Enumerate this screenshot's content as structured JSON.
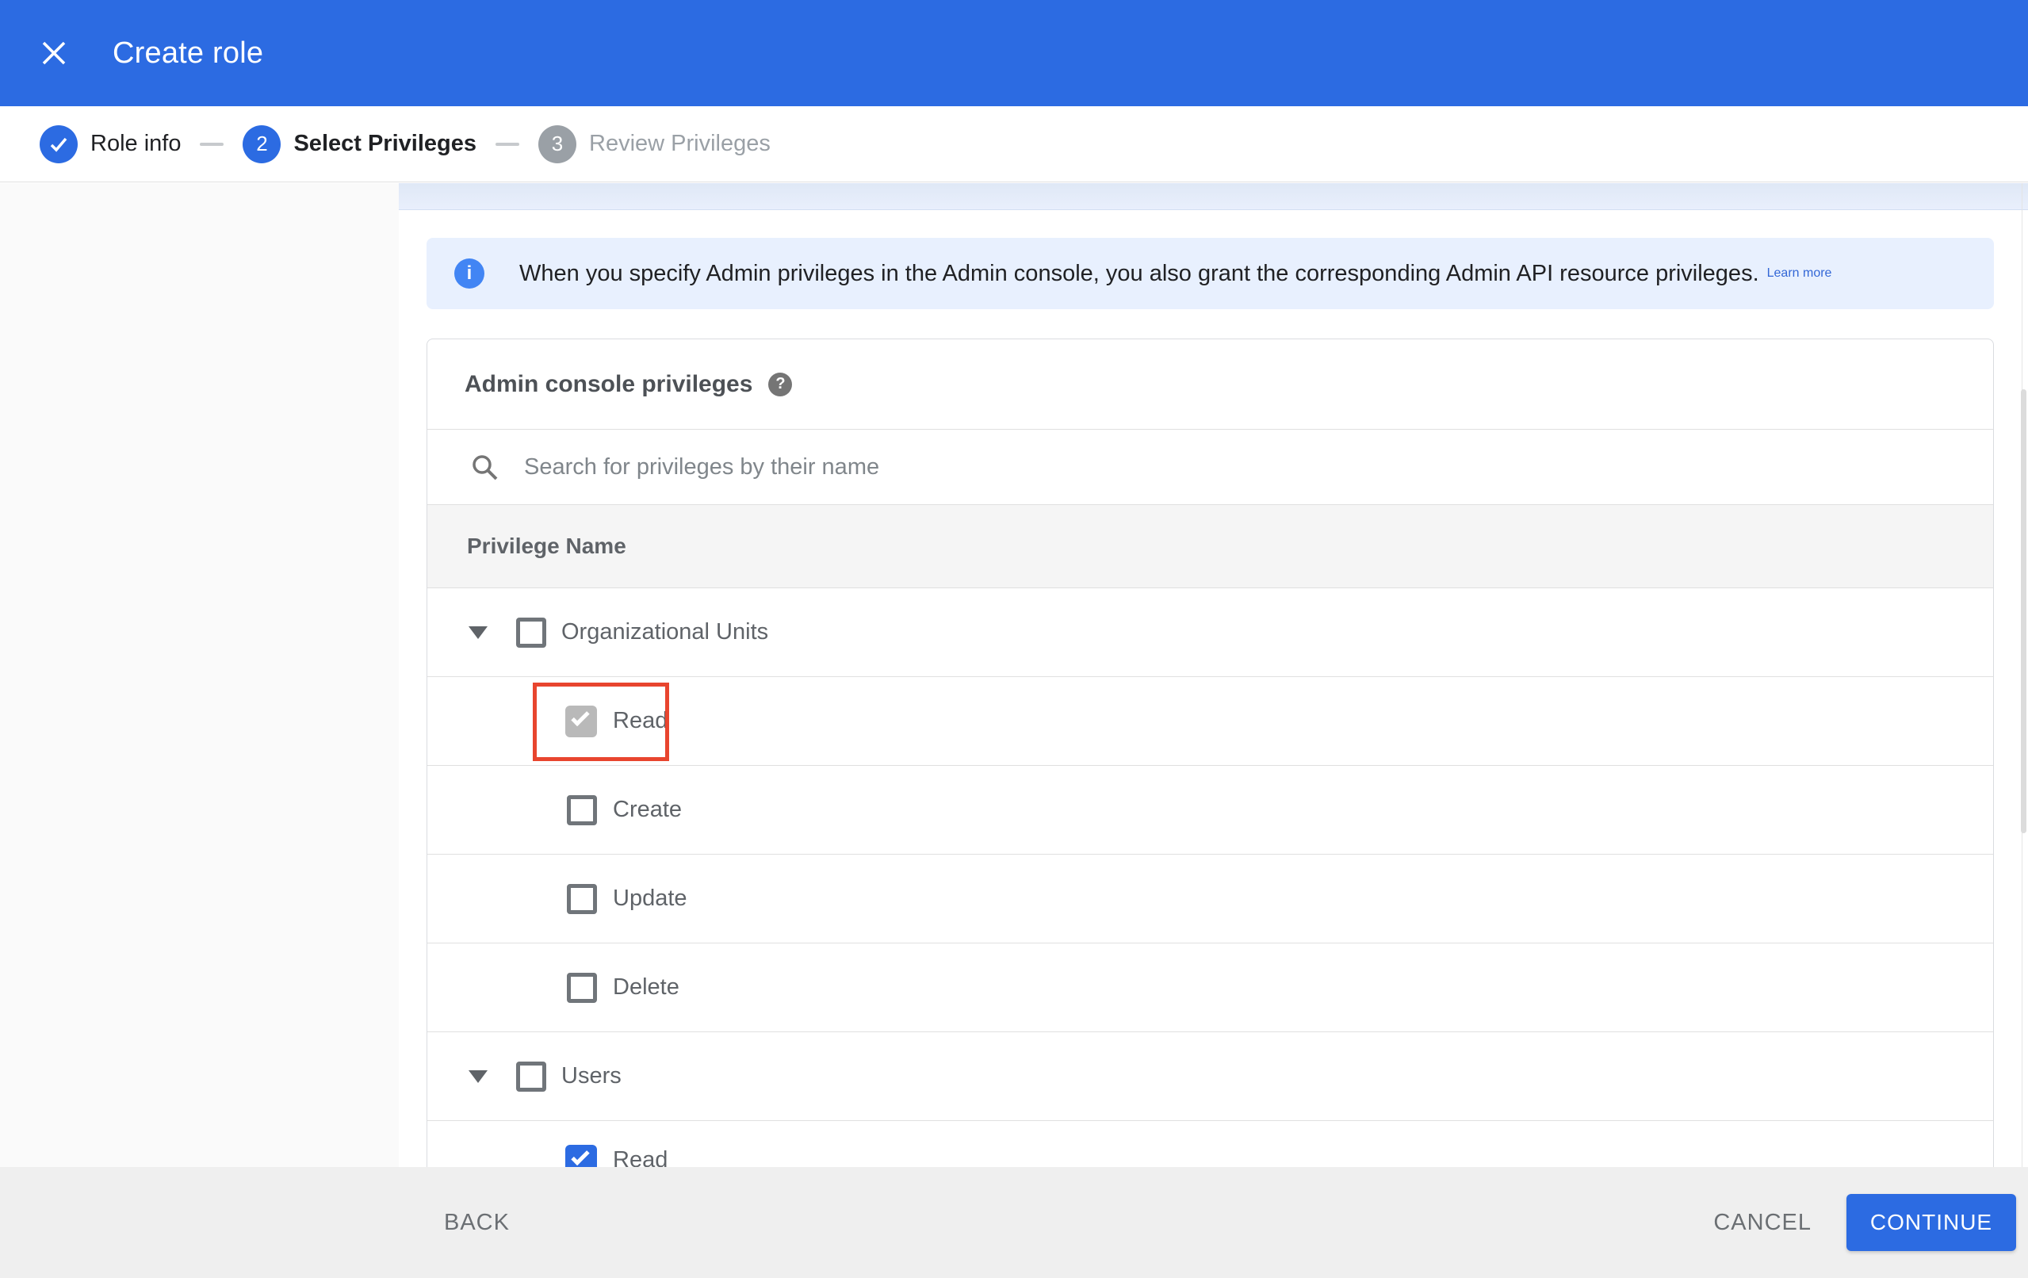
{
  "app_bar": {
    "title": "Create role"
  },
  "stepper": {
    "steps": [
      {
        "number": "1",
        "label": "Role info",
        "state": "complete"
      },
      {
        "number": "2",
        "label": "Select Privileges",
        "state": "active"
      },
      {
        "number": "3",
        "label": "Review Privileges",
        "state": "upcoming"
      }
    ]
  },
  "banner": {
    "text": "When you specify Admin privileges in the Admin console, you also grant the corresponding Admin API resource privileges.",
    "link": "Learn more"
  },
  "privileges_card": {
    "title": "Admin console privileges",
    "search_placeholder": "Search for privileges by their name",
    "column_header": "Privilege Name",
    "rows": [
      {
        "label": "Organizational Units",
        "type": "group",
        "expanded": true,
        "checked": false
      },
      {
        "label": "Read",
        "type": "child",
        "checked": true,
        "disabled": true,
        "highlighted": true
      },
      {
        "label": "Create",
        "type": "child",
        "checked": false
      },
      {
        "label": "Update",
        "type": "child",
        "checked": false
      },
      {
        "label": "Delete",
        "type": "child",
        "checked": false
      },
      {
        "label": "Users",
        "type": "group",
        "expanded": true,
        "checked": false
      },
      {
        "label": "Read",
        "type": "child",
        "checked": true,
        "partially_visible": true
      }
    ]
  },
  "footer": {
    "back": "BACK",
    "cancel": "CANCEL",
    "continue": "CONTINUE"
  },
  "colors": {
    "primary_blue": "#2c6be2",
    "info_icon_blue": "#4285f4",
    "banner_bg": "#e8f0fe",
    "link_blue": "#3367d6",
    "highlight_red": "#e8452e",
    "disabled_check_gray": "#b9b9b9"
  }
}
